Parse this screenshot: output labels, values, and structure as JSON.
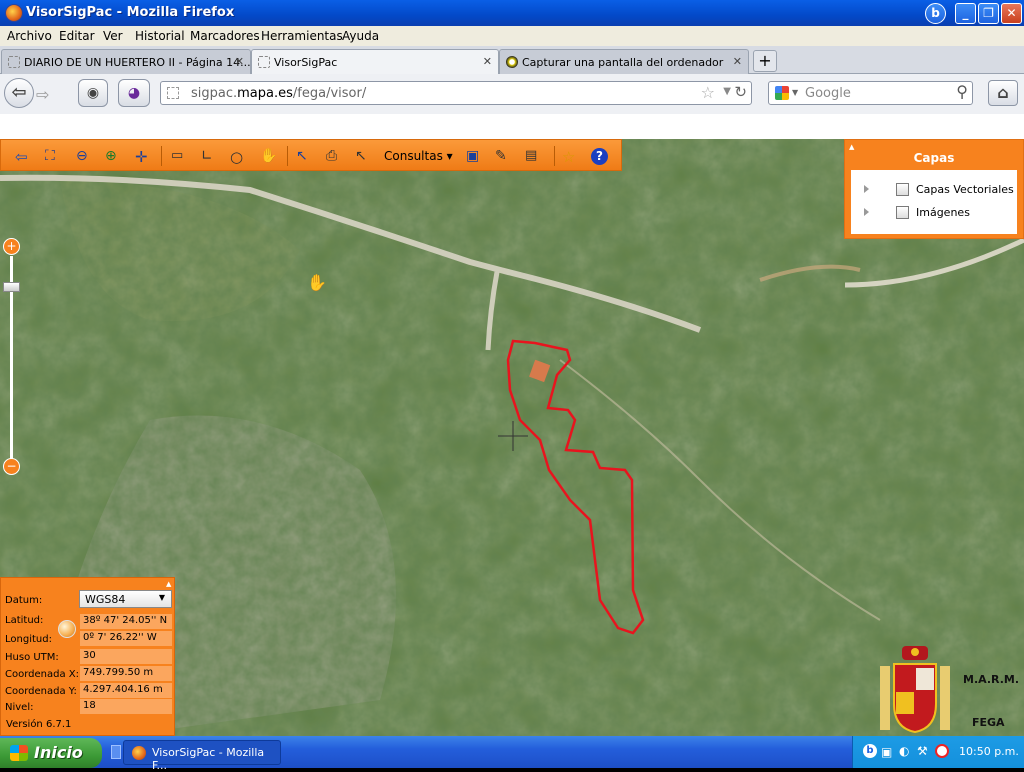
{
  "window": {
    "title": "VisorSigPac - Mozilla Firefox"
  },
  "menubar": {
    "items": [
      "Archivo",
      "Editar",
      "Ver",
      "Historial",
      "Marcadores",
      "Herramientas",
      "Ayuda"
    ]
  },
  "tabs": [
    {
      "label": "DIARIO DE UN HUERTERO II - Página 14...",
      "active": false
    },
    {
      "label": "VisorSigPac",
      "active": true
    },
    {
      "label": "Capturar una pantalla del ordenador",
      "active": false
    }
  ],
  "address": {
    "prefix": "sigpac.",
    "host": "mapa.es",
    "path": "/fega/visor/"
  },
  "search": {
    "placeholder": "Google"
  },
  "toolbar": {
    "consultas_label": "Consultas"
  },
  "capas": {
    "title": "Capas",
    "items": [
      {
        "label": "Capas Vectoriales",
        "checked": false
      },
      {
        "label": "Imágenes",
        "checked": false
      }
    ]
  },
  "coords": {
    "datum_label": "Datum:",
    "datum_value": "WGS84",
    "lat_label": "Latitud:",
    "lat_value": "38º 47' 24.05'' N",
    "lon_label": "Longitud:",
    "lon_value": "0º 7' 26.22'' W",
    "huso_label": "Huso UTM:",
    "huso_value": "30",
    "x_label": "Coordenada X:",
    "x_value": "749.799.50 m",
    "y_label": "Coordenada Y:",
    "y_value": "4.297.404.16 m",
    "nivel_label": "Nivel:",
    "nivel_value": "18",
    "version": "Versión 6.7.1"
  },
  "logo": {
    "marm": "M.A.R.M.",
    "fega": "FEGA"
  },
  "taskbar": {
    "start_label": "Inicio",
    "task_label": "VisorSigPac - Mozilla F...",
    "clock": "10:50 p.m."
  },
  "colors": {
    "accent": "#f7821e",
    "parcel": "#e8141e",
    "xp_blue": "#245edb"
  }
}
